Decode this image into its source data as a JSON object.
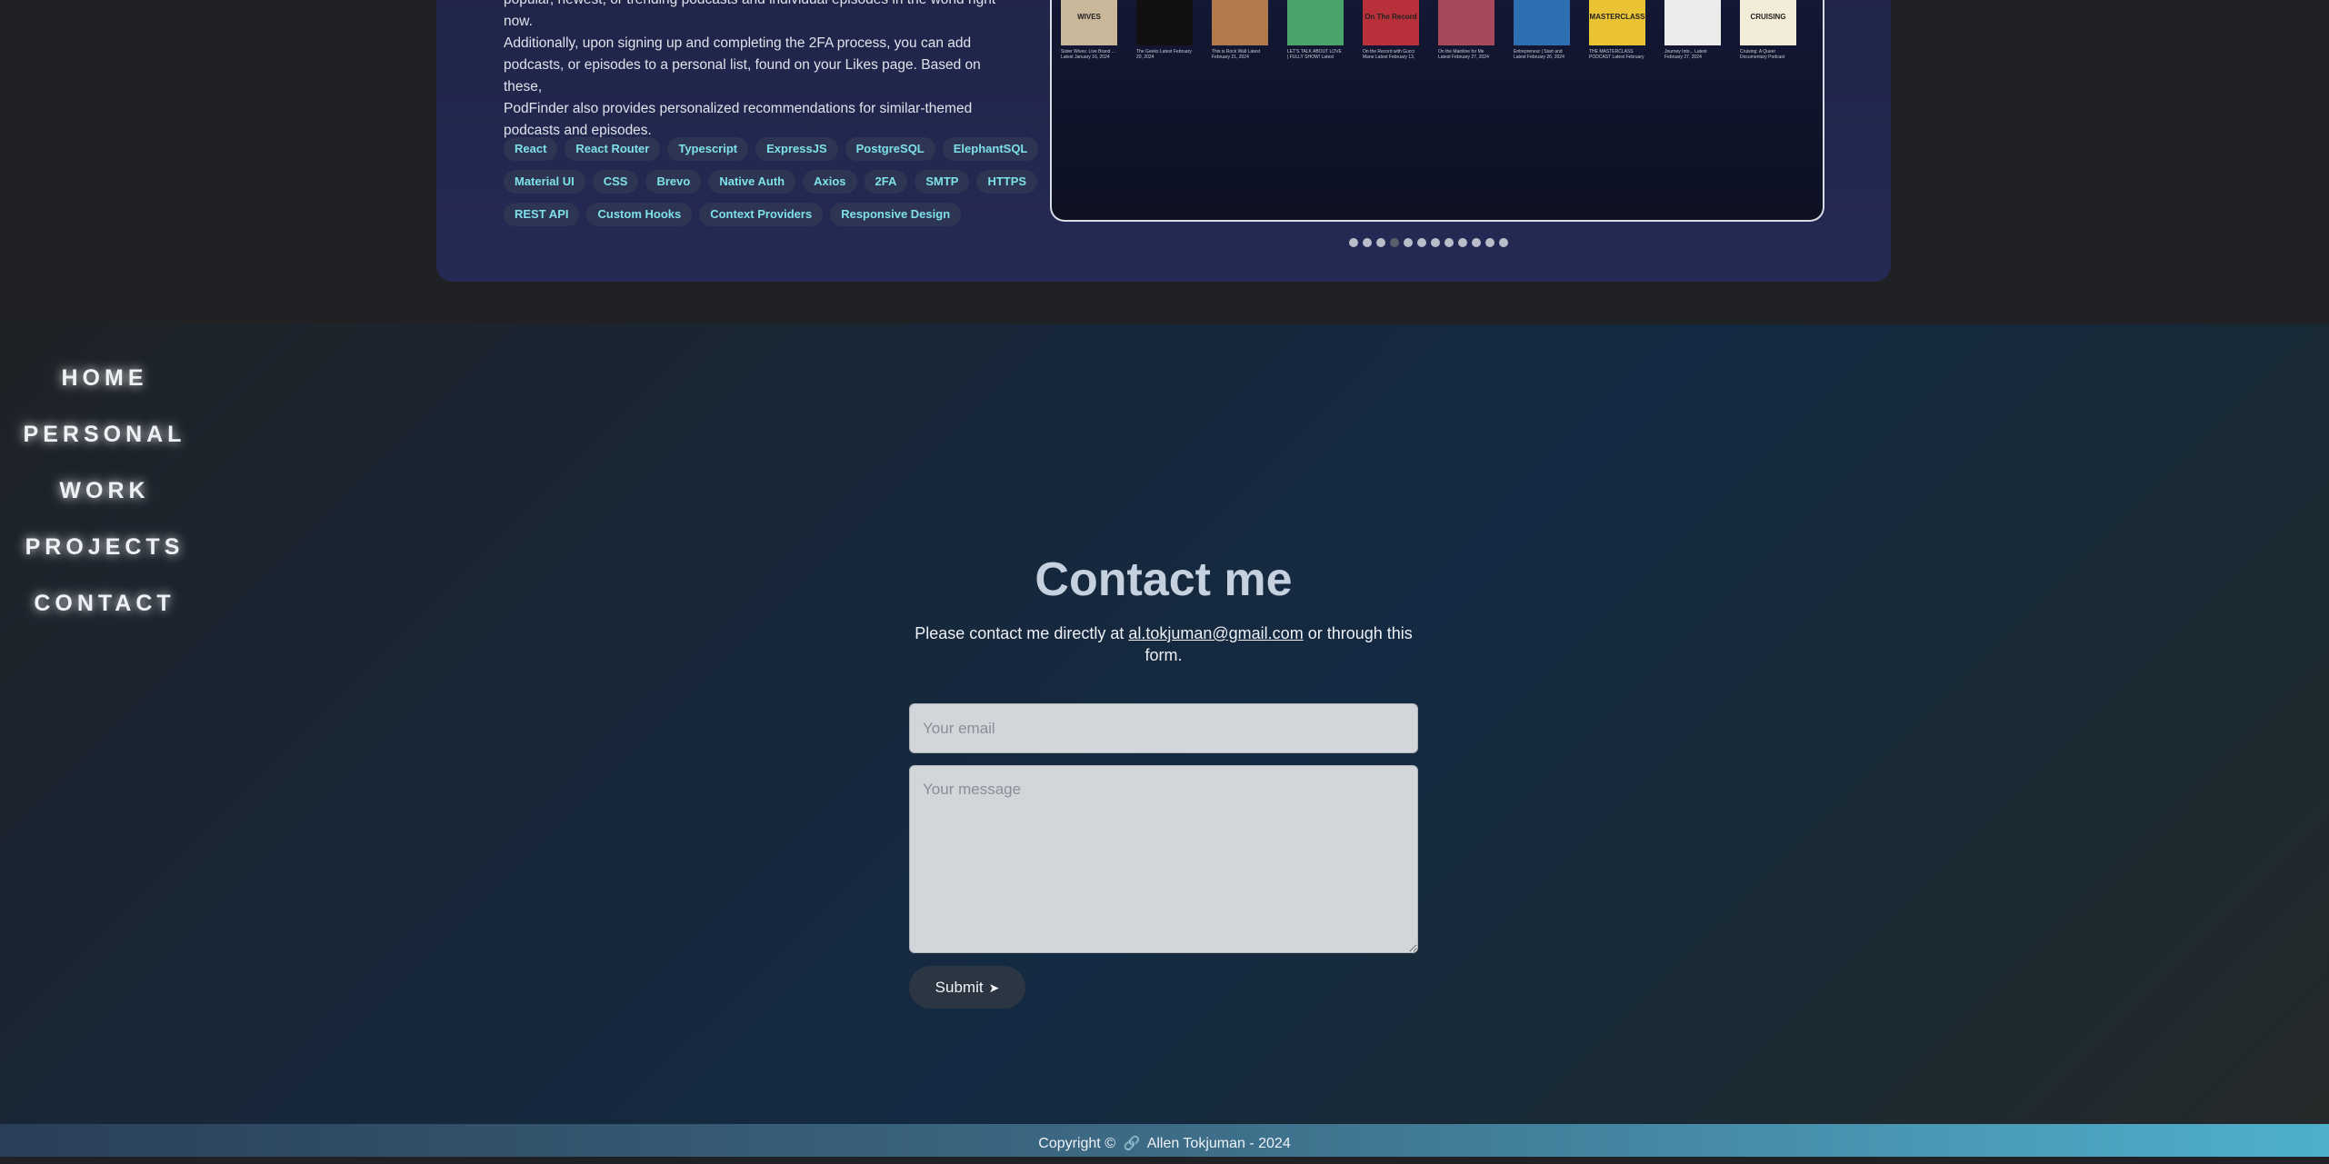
{
  "project": {
    "description_lines": [
      "popular, newest, or trending podcasts and individual episodes in the world right now.",
      "Additionally, upon signing up and completing the 2FA process, you can add",
      "podcasts, or episodes to a personal list, found on your Likes page. Based on these,",
      "PodFinder also provides personalized recommendations for similar-themed",
      "podcasts and episodes."
    ],
    "tag_rows": [
      [
        "React",
        "React Router",
        "Typescript",
        "ExpressJS",
        "PostgreSQL",
        "ElephantSQL"
      ],
      [
        "Material UI",
        "CSS",
        "Brevo",
        "Native Auth",
        "Axios",
        "2FA",
        "SMTP",
        "HTTPS"
      ],
      [
        "REST API",
        "Custom Hooks",
        "Context Providers",
        "Responsive Design"
      ]
    ],
    "preview_podcasts": [
      {
        "thumb": "WIVES",
        "color": "#c9b79a",
        "caption": "Sister Wives: Live Brand ... Latest January 16, 2024"
      },
      {
        "thumb": "",
        "color": "#111111",
        "caption": "The Geeks Latest February 20, 2024"
      },
      {
        "thumb": "",
        "color": "#b07a4c",
        "caption": "This is Rock Wall Latest February 21, 2024"
      },
      {
        "thumb": "",
        "color": "#4aa36b",
        "caption": "LET'S TALK ABOUT LOVE | FULLY SHOW! Latest February 14, 2024"
      },
      {
        "thumb": "On The Record",
        "color": "#b8303a",
        "caption": "On the Record with Gucci Mane Latest February 13, 2024"
      },
      {
        "thumb": "",
        "color": "#a6495a",
        "caption": "On the Mainline for Me Latest February 27, 2024"
      },
      {
        "thumb": "",
        "color": "#2d6fb0",
        "caption": "Entrepreneur | Start and Latest February 26, 2024"
      },
      {
        "thumb": "MASTERCLASS",
        "color": "#e9c334",
        "caption": "THE MASTERCLASS PODCAST Latest February 26, 2024"
      },
      {
        "thumb": "",
        "color": "#ececec",
        "caption": "Journey Into... Latest February 27, 2024"
      },
      {
        "thumb": "CRUISING",
        "color": "#f3ecd8",
        "caption": "Cruising: A Queer Documentary Podcast Latest February 21, 2024"
      }
    ],
    "carousel": {
      "total": 12,
      "active_index": 3
    }
  },
  "nav": {
    "items": [
      "HOME",
      "PERSONAL",
      "WORK",
      "PROJECTS",
      "CONTACT"
    ]
  },
  "contact": {
    "title": "Contact me",
    "intro_before": "Please contact me directly at ",
    "email": "al.tokjuman@gmail.com",
    "intro_after": " or through this form.",
    "email_placeholder": "Your email",
    "message_placeholder": "Your message",
    "submit_label": "Submit"
  },
  "footer": {
    "copyright": "Copyright ©",
    "name": "Allen Tokjuman - 2024"
  },
  "icons": {
    "send": "send-icon",
    "link": "link-icon"
  }
}
